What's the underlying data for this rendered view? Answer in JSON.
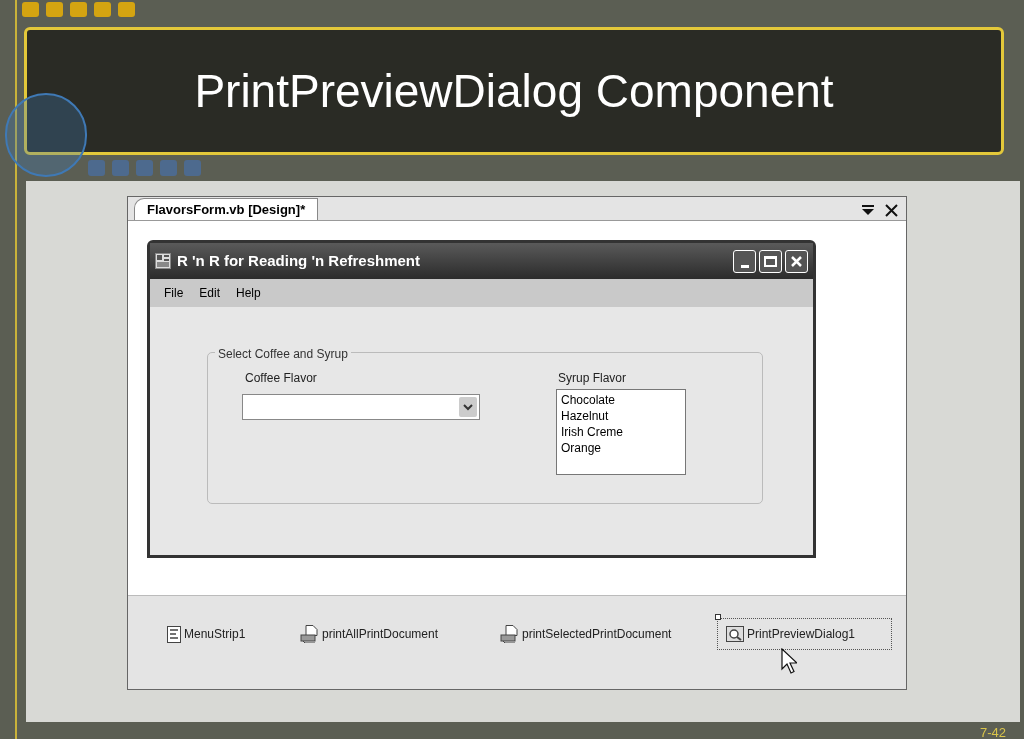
{
  "slide": {
    "title": "PrintPreviewDialog Component",
    "page_number": "7-42"
  },
  "designer": {
    "tab": {
      "label": "FlavorsForm.vb [Design]*",
      "selected": true
    },
    "form": {
      "title": "R 'n R for Reading 'n Refreshment",
      "menu": [
        "File",
        "Edit",
        "Help"
      ],
      "group": {
        "label": "Select Coffee and Syrup",
        "coffee": {
          "label": "Coffee Flavor"
        },
        "syrup": {
          "label": "Syrup Flavor",
          "items": [
            "Chocolate",
            "Hazelnut",
            "Irish Creme",
            "Orange"
          ]
        }
      }
    },
    "components": [
      {
        "label": "MenuStrip1",
        "kind": "menu",
        "selected": false
      },
      {
        "label": "printAllPrintDocument",
        "kind": "printdoc",
        "selected": false
      },
      {
        "label": "printSelectedPrintDocument",
        "kind": "printdoc",
        "selected": false
      },
      {
        "label": "PrintPreviewDialog1",
        "kind": "preview",
        "selected": true
      }
    ]
  }
}
